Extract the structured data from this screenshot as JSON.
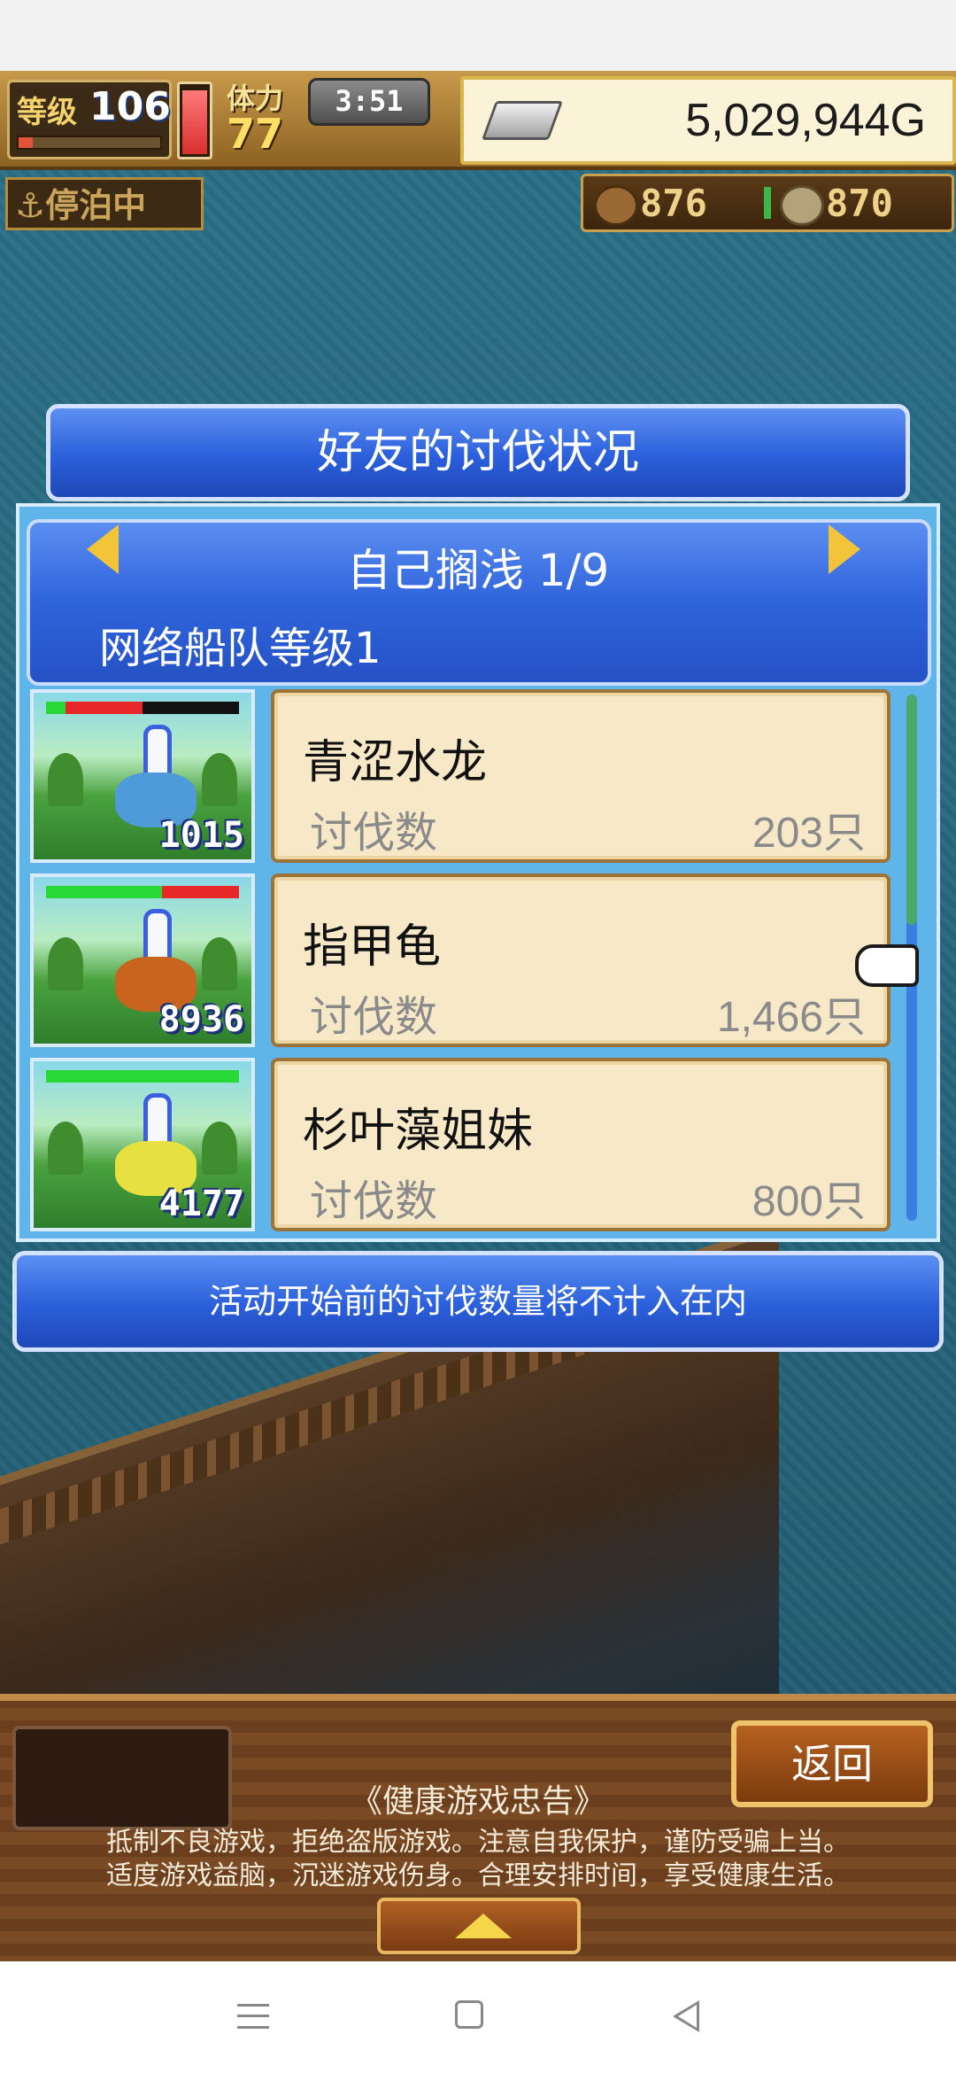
{
  "hud": {
    "level_label": "等级",
    "level_value": "106",
    "exp_fraction": 0.1,
    "hp_fraction": 0.95,
    "stamina_label": "体力",
    "stamina_value": "77",
    "clock": "3:51",
    "gold": "5,029,944G",
    "status": "⚓停泊中",
    "wood": "876",
    "coins": "870"
  },
  "dialog": {
    "title": "好友的讨伐状况",
    "page_label": "自己搁浅 1/9",
    "fleet_level": "网络船队等级1",
    "notice": "活动开始前的讨伐数量将不计入在内"
  },
  "monsters": [
    {
      "name": "青涩水龙",
      "stat_label": "讨伐数",
      "stat_value": "203只",
      "count": "1015",
      "hp_green": 0.1,
      "hp_red": 0.4,
      "monster_color": "#4f9ad8"
    },
    {
      "name": "指甲龟",
      "stat_label": "讨伐数",
      "stat_value": "1,466只",
      "count": "8936",
      "hp_green": 0.6,
      "hp_red": 0.4,
      "monster_color": "#c8641e"
    },
    {
      "name": "杉叶藻姐妹",
      "stat_label": "讨伐数",
      "stat_value": "800只",
      "count": "4177",
      "hp_green": 1.0,
      "hp_red": 0.0,
      "monster_color": "#e6e040"
    }
  ],
  "bottom": {
    "back_label": "返回",
    "health_title": "《健康游戏忠告》",
    "health_line1": "抵制不良游戏，拒绝盗版游戏。注意自我保护，谨防受骗上当。",
    "health_line2": "适度游戏益脑，沉迷游戏伤身。合理安排时间，享受健康生活。"
  },
  "colors": {
    "dialog_blue": "#2b5fdb",
    "card_beige": "#f7e8c8",
    "gold_yellow": "#f1c43a"
  }
}
